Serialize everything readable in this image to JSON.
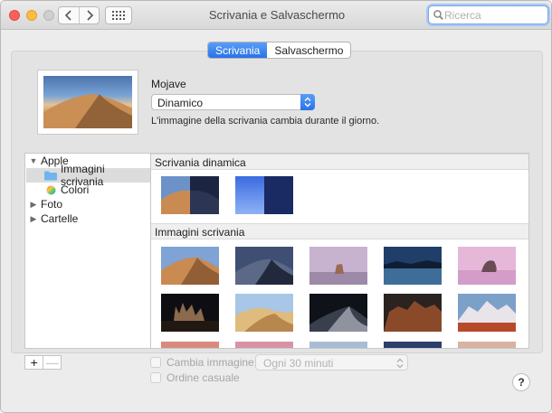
{
  "window": {
    "title": "Scrivania e Salvaschermo"
  },
  "search": {
    "placeholder": "Ricerca"
  },
  "tabs": [
    {
      "label": "Scrivania",
      "selected": true
    },
    {
      "label": "Salvaschermo",
      "selected": false
    }
  ],
  "current": {
    "name": "Mojave",
    "mode": "Dinamico",
    "description": "L'immagine della scrivania cambia durante il giorno."
  },
  "sources": [
    {
      "label": "Apple",
      "type": "group",
      "expanded": true
    },
    {
      "label": "Immagini scrivania",
      "type": "folder",
      "selected": true
    },
    {
      "label": "Colori",
      "type": "colors"
    },
    {
      "label": "Foto",
      "type": "group",
      "expanded": false
    },
    {
      "label": "Cartelle",
      "type": "group",
      "expanded": false
    }
  ],
  "sections": {
    "dynamic": "Scrivania dinamica",
    "images": "Immagini scrivania"
  },
  "options": {
    "change_label": "Cambia immagine:",
    "interval": "Ogni 30 minuti",
    "random_label": "Ordine casuale"
  },
  "buttons": {
    "add": "+",
    "remove": "—",
    "help": "?"
  },
  "colors": {
    "accent": "#2a72e8"
  }
}
